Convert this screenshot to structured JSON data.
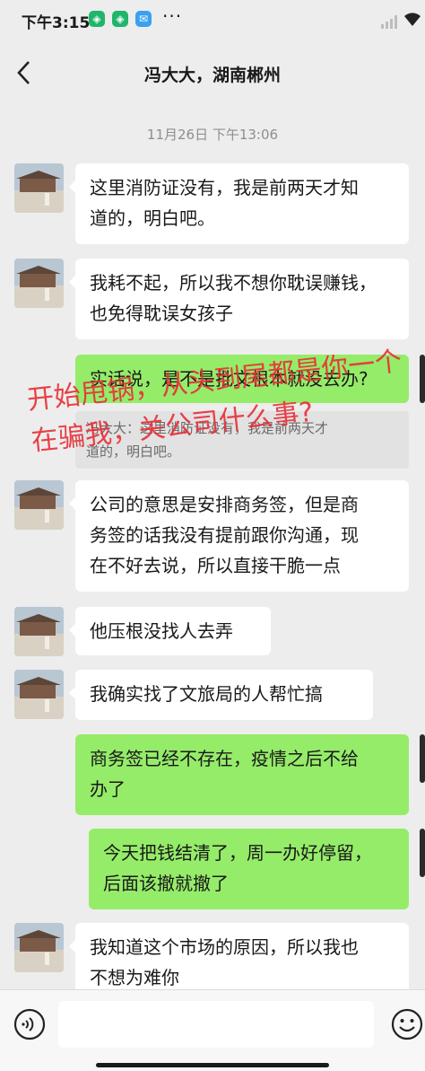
{
  "status_bar": {
    "time": "下午3:15",
    "more": "···"
  },
  "header": {
    "title": "冯大大，湖南郴州"
  },
  "timestamp": "11月26日 下午13:06",
  "messages": [
    {
      "side": "in",
      "lines": [
        "这里消防证没有，我是前两天才知",
        "道的，明白吧。"
      ]
    },
    {
      "side": "in",
      "lines": [
        "我耗不起，所以我不想你耽误赚钱，",
        "也免得耽误女孩子"
      ]
    },
    {
      "side": "out",
      "lines": [
        "实话说，是不是批文根本就没去办?"
      ]
    },
    {
      "side": "in",
      "lines": [
        "公司的意思是安排商务签，但是商",
        "务签的话我没有提前跟你沟通，现",
        "在不好去说，所以直接干脆一点"
      ]
    },
    {
      "side": "in",
      "lines": [
        "他压根没找人去弄"
      ]
    },
    {
      "side": "in",
      "lines": [
        "我确实找了文旅局的人帮忙搞"
      ]
    },
    {
      "side": "out",
      "lines": [
        "商务签已经不存在，疫情之后不给",
        "办了"
      ]
    },
    {
      "side": "out",
      "lines": [
        "今天把钱结清了，周一办好停留，",
        "后面该撤就撤了"
      ]
    },
    {
      "side": "in",
      "lines": [
        "我知道这个市场的原因，所以我也",
        "不想为难你"
      ]
    }
  ],
  "quote": {
    "lines": [
      "冯大大：这里消防证没有，我是前两天才",
      "道的，明白吧。"
    ]
  },
  "annotation": {
    "lines": [
      "开始甩锅，从头到尾都是你一个",
      "在骗我，关公司什么事?"
    ],
    "color": "#e8323a"
  },
  "input_bar": {
    "text": ""
  },
  "colors": {
    "outgoing_bubble": "#95ec69",
    "incoming_bubble": "#ffffff",
    "background": "#ededed"
  },
  "icons": [
    "back-arrow-icon",
    "voice-icon",
    "emoji-icon",
    "signal-icon",
    "wifi-icon"
  ]
}
